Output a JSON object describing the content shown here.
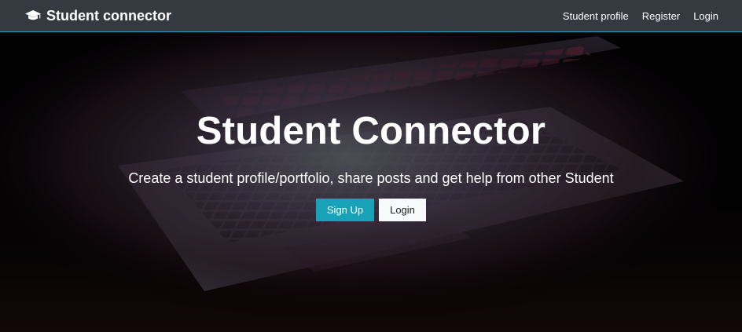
{
  "navbar": {
    "brand": "Student connector",
    "brand_icon": "graduation-cap-icon",
    "links": {
      "profile": "Student profile",
      "register": "Register",
      "login": "Login"
    }
  },
  "hero": {
    "title": "Student Connector",
    "subtitle": "Create a student profile/portfolio, share posts and get help from other Student",
    "buttons": {
      "signup": "Sign Up",
      "login": "Login"
    }
  },
  "colors": {
    "navbar_bg": "#343a40",
    "accent": "#17a2b8",
    "light_button": "#f8f9fa"
  }
}
